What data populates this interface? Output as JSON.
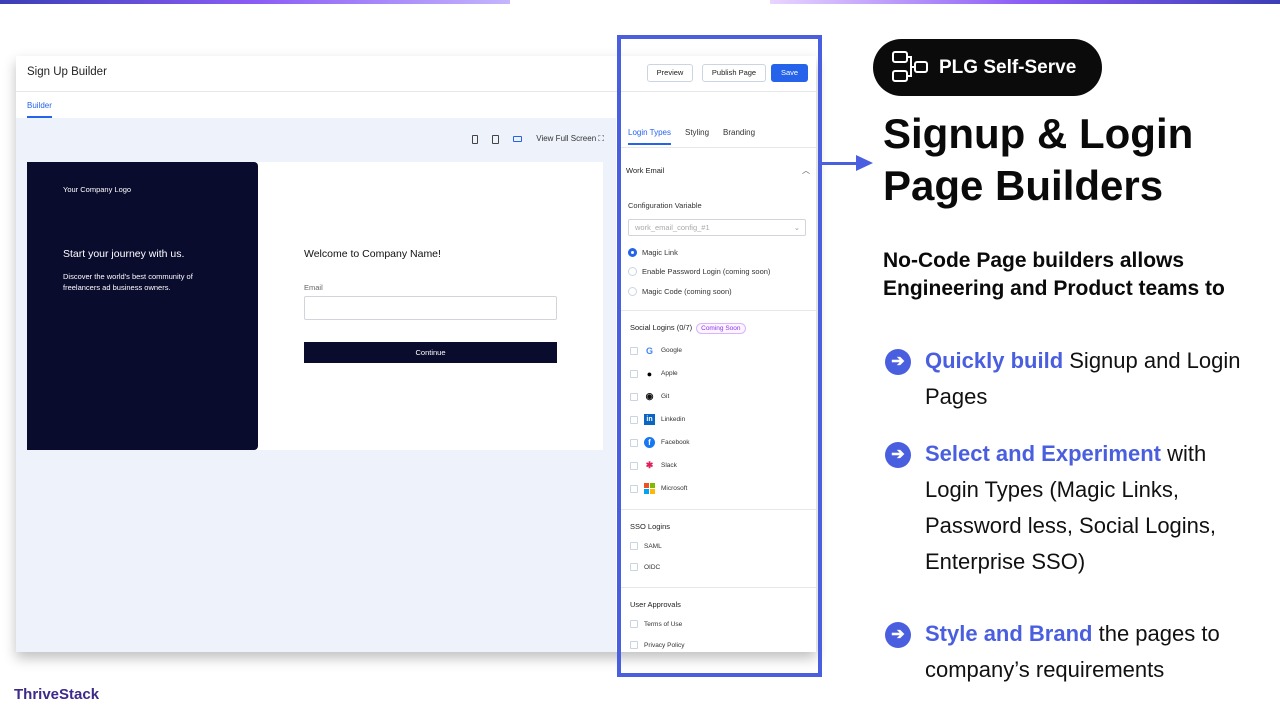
{
  "app": {
    "title": "Sign Up Builder",
    "tab_builder": "Builder",
    "view_full_screen": "View Full Screen",
    "buttons": {
      "preview": "Preview",
      "publish": "Publish Page",
      "save": "Save"
    },
    "preview": {
      "logo_text": "Your Company Logo",
      "journey": "Start your journey with us.",
      "discover": "Discover the world's best community of freelancers ad business owners.",
      "welcome": "Welcome to Company Name!",
      "email_label": "Email",
      "continue": "Continue"
    },
    "panel": {
      "tabs": [
        "Login Types",
        "Styling",
        "Branding"
      ],
      "work_email": "Work Email",
      "config_label": "Configuration Variable",
      "config_value": "work_email_config_#1",
      "radios": [
        "Magic Link",
        "Enable Password Login (coming soon)",
        "Magic Code (coming soon)"
      ],
      "social_title": "Social Logins (0/7)",
      "coming_soon": "Coming Soon",
      "socials": [
        "Google",
        "Apple",
        "Git",
        "Linkedin",
        "Facebook",
        "Slack",
        "Microsoft"
      ],
      "sso_title": "SSO Logins",
      "sso": [
        "SAML",
        "OIDC"
      ],
      "approvals_title": "User Approvals",
      "approvals": [
        "Terms of Use",
        "Privacy Policy"
      ]
    }
  },
  "pill_label": "PLG Self-Serve",
  "headline": "Signup & Login Page Builders",
  "subheadline": "No-Code Page builders allows Engineering and Product teams to",
  "bullets": [
    {
      "highlight": "Quickly build",
      "rest": " Signup and Login Pages"
    },
    {
      "highlight": "Select and Experiment",
      "rest": " with Login Types (Magic Links, Password less, Social Logins, Enterprise SSO)"
    },
    {
      "highlight": "Style and Brand",
      "rest": " the pages to company’s requirements"
    }
  ],
  "brand": "ThriveStack",
  "colors": {
    "accent": "#4a5fe0",
    "dark_pane": "#0a0c2e",
    "save_button": "#2563eb"
  }
}
